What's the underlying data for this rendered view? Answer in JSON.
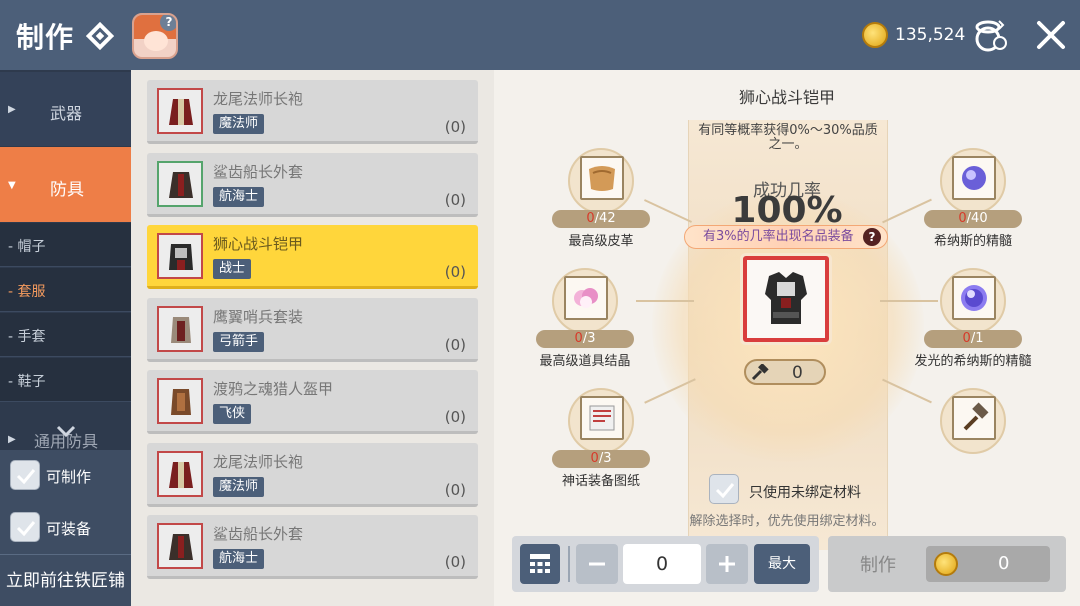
{
  "header": {
    "title": "制作",
    "currency_amount": "135,524"
  },
  "sidebar": {
    "categories": [
      {
        "label": "武器"
      },
      {
        "label": "防具"
      },
      {
        "label": "通用防具"
      }
    ],
    "subcategories": [
      "帽子",
      "套服",
      "手套",
      "鞋子"
    ],
    "filters": [
      {
        "label": "可制作"
      },
      {
        "label": "可装备"
      }
    ],
    "blacksmith_link": "立即前往铁匠铺"
  },
  "items": [
    {
      "name": "龙尾法师长袍",
      "class": "魔法师",
      "count": "(0)"
    },
    {
      "name": "鲨齿船长外套",
      "class": "航海士",
      "count": "(0)"
    },
    {
      "name": "狮心战斗铠甲",
      "class": "战士",
      "count": "(0)"
    },
    {
      "name": "鹰翼哨兵套装",
      "class": "弓箭手",
      "count": "(0)"
    },
    {
      "name": "渡鸦之魂猎人盔甲",
      "class": "飞侠",
      "count": "(0)"
    },
    {
      "name": "龙尾法师长袍",
      "class": "魔法师",
      "count": "(0)"
    },
    {
      "name": "鲨齿船长外套",
      "class": "航海士",
      "count": "(0)"
    }
  ],
  "detail": {
    "title": "狮心战斗铠甲",
    "description": "有同等概率获得0%～30%品质之一。",
    "rate_label": "成功几率",
    "rate_value": "100%",
    "bonus_text": "有3%的几率出现名品装备",
    "hammer_count": "0",
    "materials": [
      {
        "have": "0",
        "need": "/42",
        "name": "最高级皮革"
      },
      {
        "have": "0",
        "need": "/3",
        "name": "最高级道具结晶"
      },
      {
        "have": "0",
        "need": "/3",
        "name": "神话装备图纸"
      },
      {
        "have": "0",
        "need": "/40",
        "name": "希纳斯的精髓"
      },
      {
        "have": "0",
        "need": "/1",
        "name": "发光的希纳斯的精髓"
      }
    ],
    "only_unbound_label": "只使用未绑定材料",
    "hint": "解除选择时，优先使用绑定材料。"
  },
  "footer": {
    "quantity": "0",
    "max_label": "最大",
    "make_label": "制作",
    "cost": "0"
  },
  "colors": {
    "topbar": "#4c5f79",
    "sidebar": "#2e3a4d",
    "active_category": "#ee7e47",
    "selected_item": "#ffd63b",
    "rare_red": "#d93d3d"
  }
}
